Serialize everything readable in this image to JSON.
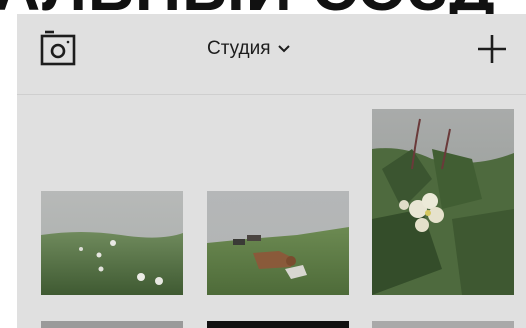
{
  "header": {
    "title": "Студия",
    "camera_icon": "camera-icon",
    "dropdown_icon": "chevron-down-icon",
    "add_icon": "plus-icon"
  },
  "gallery": {
    "items": [
      {
        "name": "foggy-meadow-flowers"
      },
      {
        "name": "cows-on-hillside"
      },
      {
        "name": "white-flower-bush"
      },
      {
        "name": "partial-photo"
      },
      {
        "name": "dark-partial-photo"
      },
      {
        "name": "partial-photo"
      }
    ]
  },
  "colors": {
    "overlay": "#e0e0e0",
    "text": "#1d1d1d",
    "background": "#ffffff"
  }
}
